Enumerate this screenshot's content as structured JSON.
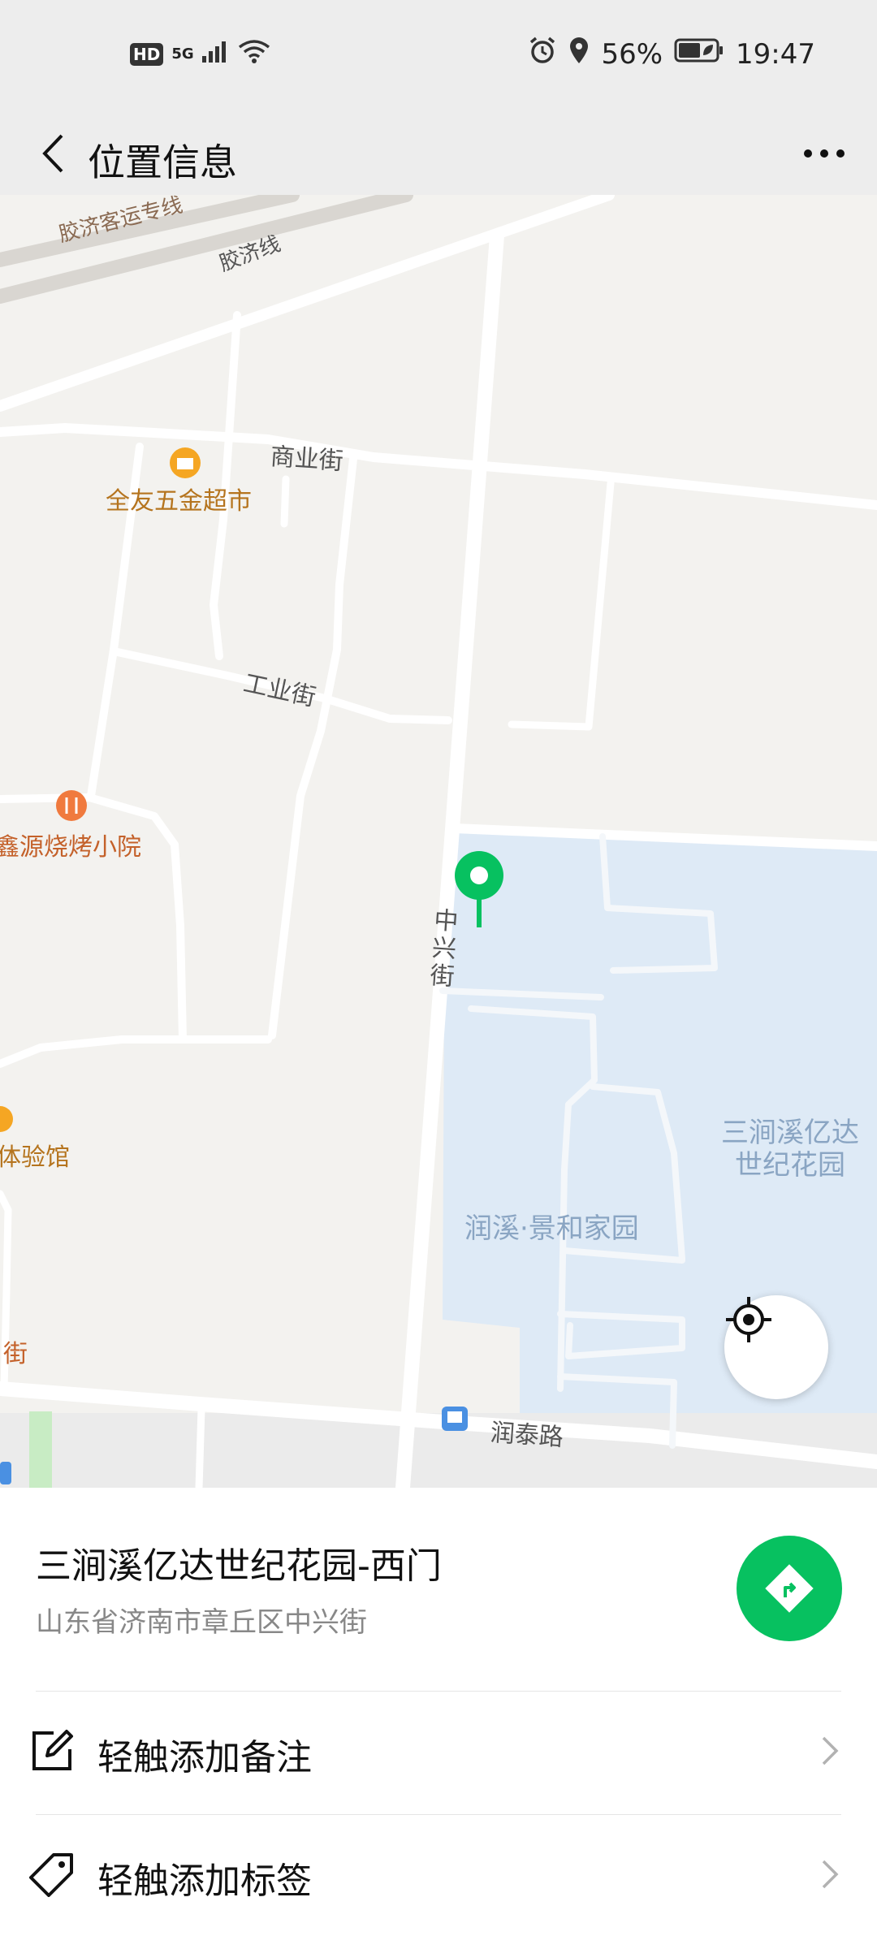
{
  "status_bar": {
    "hd": "HD",
    "network": "5G",
    "battery": "56%",
    "time": "19:47",
    "icons": [
      "hd-icon",
      "signal-icon",
      "wifi-icon",
      "alarm-icon",
      "location-icon",
      "battery-icon"
    ]
  },
  "header": {
    "title": "位置信息",
    "back_icon": "chevron-left-icon",
    "more_icon": "more-icon"
  },
  "map": {
    "rail_labels": [
      "胶济客运专线",
      "胶济线"
    ],
    "street_labels": [
      "商业街",
      "工业街",
      "中兴街",
      "润泰路",
      "街"
    ],
    "pois": [
      "全友五金超市",
      "鑫源烧烤小院",
      "体验馆"
    ],
    "area_labels": [
      "三涧溪亿达世纪花园",
      "润溪·景和家园"
    ],
    "pin_color": "#07c160",
    "locate_icon": "crosshair-icon"
  },
  "place": {
    "name": "三涧溪亿达世纪花园-西门",
    "address": "山东省济南市章丘区中兴街",
    "navigate_icon": "navigation-icon",
    "accent_color": "#07c160"
  },
  "actions": [
    {
      "label": "轻触添加备注",
      "icon": "edit-icon"
    },
    {
      "label": "轻触添加标签",
      "icon": "tag-icon"
    }
  ]
}
